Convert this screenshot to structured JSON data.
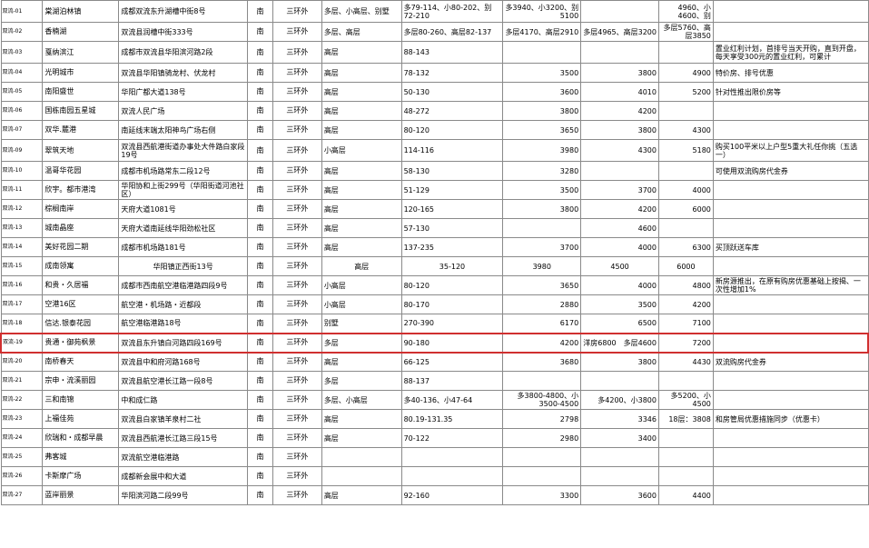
{
  "rows": [
    {
      "id": "双流-01",
      "name": "棠湖泊林镇",
      "addr": "成都双流东升湖槽中街8号",
      "dir": "南",
      "ring": "三环外",
      "type": "多层、小高层、别墅",
      "area": "多79-114、小80-202、别72-210",
      "p1": "多3940、小3200、别5100",
      "p2": "",
      "p3": "4960、小4600、别",
      "note": ""
    },
    {
      "id": "双流-02",
      "name": "香楠湖",
      "addr": "双流县润槽中街333号",
      "dir": "南",
      "ring": "三环外",
      "type": "多层、高层",
      "area": "多层80-260、高层82-137",
      "p1": "多层4170、高层2910",
      "p2": "多层4965、高层3200",
      "p3": "多层5760、高层3850",
      "note": ""
    },
    {
      "id": "双流-03",
      "name": "戛纳滨江",
      "addr": "成都市双流县华阳滨河路2段",
      "dir": "南",
      "ring": "三环外",
      "type": "高层",
      "area": "88-143",
      "p1": "",
      "p2": "",
      "p3": "",
      "note": "置业红利计划，首排号当天开购，直到开盘，每天享受300元的置业红利，可累计"
    },
    {
      "id": "双流-04",
      "name": "光明城市",
      "addr": "双流县华阳镇骑龙村、伏龙村",
      "dir": "南",
      "ring": "三环外",
      "type": "高层",
      "area": "78-132",
      "p1": "3500",
      "p2": "3800",
      "p3": "4900",
      "note": "特价房、排号优惠"
    },
    {
      "id": "双流-05",
      "name": "南阳盛世",
      "addr": "华阳广都大道138号",
      "dir": "南",
      "ring": "三环外",
      "type": "高层",
      "area": "50-130",
      "p1": "3600",
      "p2": "4010",
      "p3": "5200",
      "note": "针对性推出限价房等"
    },
    {
      "id": "双流-06",
      "name": "国栋南园五星城",
      "addr": "双流人民广场",
      "dir": "南",
      "ring": "三环外",
      "type": "高层",
      "area": "48-272",
      "p1": "3800",
      "p2": "4200",
      "p3": "",
      "note": ""
    },
    {
      "id": "双流-07",
      "name": "双华.麓港",
      "addr": "南延线末端太阳神鸟广场右侧",
      "dir": "南",
      "ring": "三环外",
      "type": "高层",
      "area": "80-120",
      "p1": "3650",
      "p2": "3800",
      "p3": "4300",
      "note": ""
    },
    {
      "id": "双流-09",
      "name": "翠筑天地",
      "addr": "双流县西航港街道办事处大件路白家段19号",
      "dir": "南",
      "ring": "三环外",
      "type": "小高层",
      "area": "114-116",
      "p1": "3980",
      "p2": "4300",
      "p3": "5180",
      "note": "购买100平米以上户型5重大礼任你挑（五选一）"
    },
    {
      "id": "双流-10",
      "name": "温哥华花园",
      "addr": "成都市机场路常东二段12号",
      "dir": "南",
      "ring": "三环外",
      "type": "高层",
      "area": "58-130",
      "p1": "3280",
      "p2": "",
      "p3": "",
      "note": "可使用双流购房代金券"
    },
    {
      "id": "双流-11",
      "name": "欣宇。都市港湾",
      "addr": "华阳协和上街299号（华阳街道河池社区）",
      "dir": "南",
      "ring": "三环外",
      "type": "高层",
      "area": "51-129",
      "p1": "3500",
      "p2": "3700",
      "p3": "4000",
      "note": ""
    },
    {
      "id": "双流-12",
      "name": "棕榈南岸",
      "addr": "天府大道1081号",
      "dir": "南",
      "ring": "三环外",
      "type": "高层",
      "area": "120-165",
      "p1": "3800",
      "p2": "4200",
      "p3": "6000",
      "note": ""
    },
    {
      "id": "双流-13",
      "name": "城南晶座",
      "addr": "天府大道南延线华阳劲松社区",
      "dir": "南",
      "ring": "三环外",
      "type": "高层",
      "area": "57-130",
      "p1": "",
      "p2": "4600",
      "p3": "",
      "note": ""
    },
    {
      "id": "双流-14",
      "name": "美好花园二期",
      "addr": "成都市机场路181号",
      "dir": "南",
      "ring": "三环外",
      "type": "高层",
      "area": "137-235",
      "p1": "3700",
      "p2": "4000",
      "p3": "6300",
      "note": "买顶跃送车库"
    },
    {
      "id": "双流-15",
      "name": "成南领寓",
      "addr": "华阳镇正西街13号",
      "dir": "南",
      "ring": "三环外",
      "type": "高层",
      "area": "35-120",
      "p1": "3980",
      "p2": "4500",
      "p3": "6000",
      "note": "",
      "alt": true
    },
    {
      "id": "双流-16",
      "name": "和贵・久居福",
      "addr": "成都市西南航空港临港路四段9号",
      "dir": "南",
      "ring": "三环外",
      "type": "小高层",
      "area": "80-120",
      "p1": "3650",
      "p2": "4000",
      "p3": "4800",
      "note": "新房源推出，在原有购房优惠基础上按揭、一次性增加1%"
    },
    {
      "id": "双流-17",
      "name": "空港16区",
      "addr": "航空港・机场路・近都段",
      "dir": "南",
      "ring": "三环外",
      "type": "小高层",
      "area": "80-170",
      "p1": "2880",
      "p2": "3500",
      "p3": "4200",
      "note": ""
    },
    {
      "id": "双流-18",
      "name": "信达.银泰花园",
      "addr": "航空港临港路18号",
      "dir": "南",
      "ring": "三环外",
      "type": "别墅",
      "area": "270-390",
      "p1": "6170",
      "p2": "6500",
      "p3": "7100",
      "note": ""
    },
    {
      "id": "双流-19",
      "name": "贵通・御苑枫景",
      "addr": "双流县东升镇白河路四段169号",
      "dir": "南",
      "ring": "三环外",
      "type": "多层",
      "area": "90-180",
      "p1": "4200",
      "p2": "洋房6800　多层4600",
      "p3": "7200",
      "note": "",
      "hl": true
    },
    {
      "id": "双流-20",
      "name": "南桥春天",
      "addr": "双流县中和府河路168号",
      "dir": "南",
      "ring": "三环外",
      "type": "高层",
      "area": "66-125",
      "p1": "3680",
      "p2": "3800",
      "p3": "4430",
      "note": "双流购房代金券"
    },
    {
      "id": "双流-21",
      "name": "宗申・流溪丽园",
      "addr": "双流县航空港长江路一段8号",
      "dir": "南",
      "ring": "三环外",
      "type": "多层",
      "area": "88-137",
      "p1": "",
      "p2": "",
      "p3": "",
      "note": ""
    },
    {
      "id": "双流-22",
      "name": "三和南锦",
      "addr": "中和成仁路",
      "dir": "南",
      "ring": "三环外",
      "type": "多层、小高层",
      "area": "多40-136、小47-64",
      "p1": "多3800-4800、小3500-4500",
      "p2": "多4200、小3800",
      "p3": "多5200、小4500",
      "note": ""
    },
    {
      "id": "双流-23",
      "name": "上福佳苑",
      "addr": "双流县白家镇羊泉村二社",
      "dir": "南",
      "ring": "三环外",
      "type": "高层",
      "area": "80.19-131.35",
      "p1": "2798",
      "p2": "3346",
      "p3": "18层：3808",
      "note": "和房管局优惠措施同步（优惠卡）"
    },
    {
      "id": "双流-24",
      "name": "欣瑞和・成都早晨",
      "addr": "双流县西航港长江路三段15号",
      "dir": "南",
      "ring": "三环外",
      "type": "高层",
      "area": "70-122",
      "p1": "2980",
      "p2": "3400",
      "p3": "",
      "note": ""
    },
    {
      "id": "双流-25",
      "name": "弗客城",
      "addr": "双流航空港临港路",
      "dir": "南",
      "ring": "三环外",
      "type": "",
      "area": "",
      "p1": "",
      "p2": "",
      "p3": "",
      "note": ""
    },
    {
      "id": "双流-26",
      "name": "卡斯摩广场",
      "addr": "成都新会展中和大道",
      "dir": "南",
      "ring": "三环外",
      "type": "",
      "area": "",
      "p1": "",
      "p2": "",
      "p3": "",
      "note": ""
    },
    {
      "id": "双流-27",
      "name": "蓝岸丽景",
      "addr": "华阳滨河路二段99号",
      "dir": "南",
      "ring": "三环外",
      "type": "高层",
      "area": "92-160",
      "p1": "3300",
      "p2": "3600",
      "p3": "4400",
      "note": ""
    }
  ]
}
